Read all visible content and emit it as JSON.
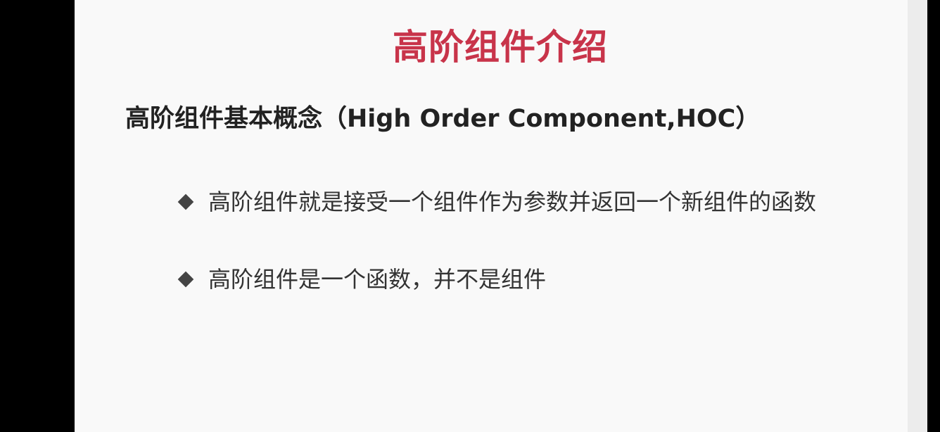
{
  "slide": {
    "title": "高阶组件介绍",
    "subtitle": "高阶组件基本概念（High Order Component,HOC）",
    "bullets": [
      {
        "icon": "diamond-bullet-icon",
        "text": "高阶组件就是接受一个组件作为参数并返回一个新组件的函数"
      },
      {
        "icon": "diamond-bullet-icon",
        "text": "高阶组件是一个函数，并不是组件"
      }
    ]
  },
  "colors": {
    "title": "#c8344a",
    "subtitle": "#222222",
    "body_text": "#333333",
    "bullet": "#444444",
    "slide_background": "#f9f9f9",
    "frame": "#000000"
  }
}
